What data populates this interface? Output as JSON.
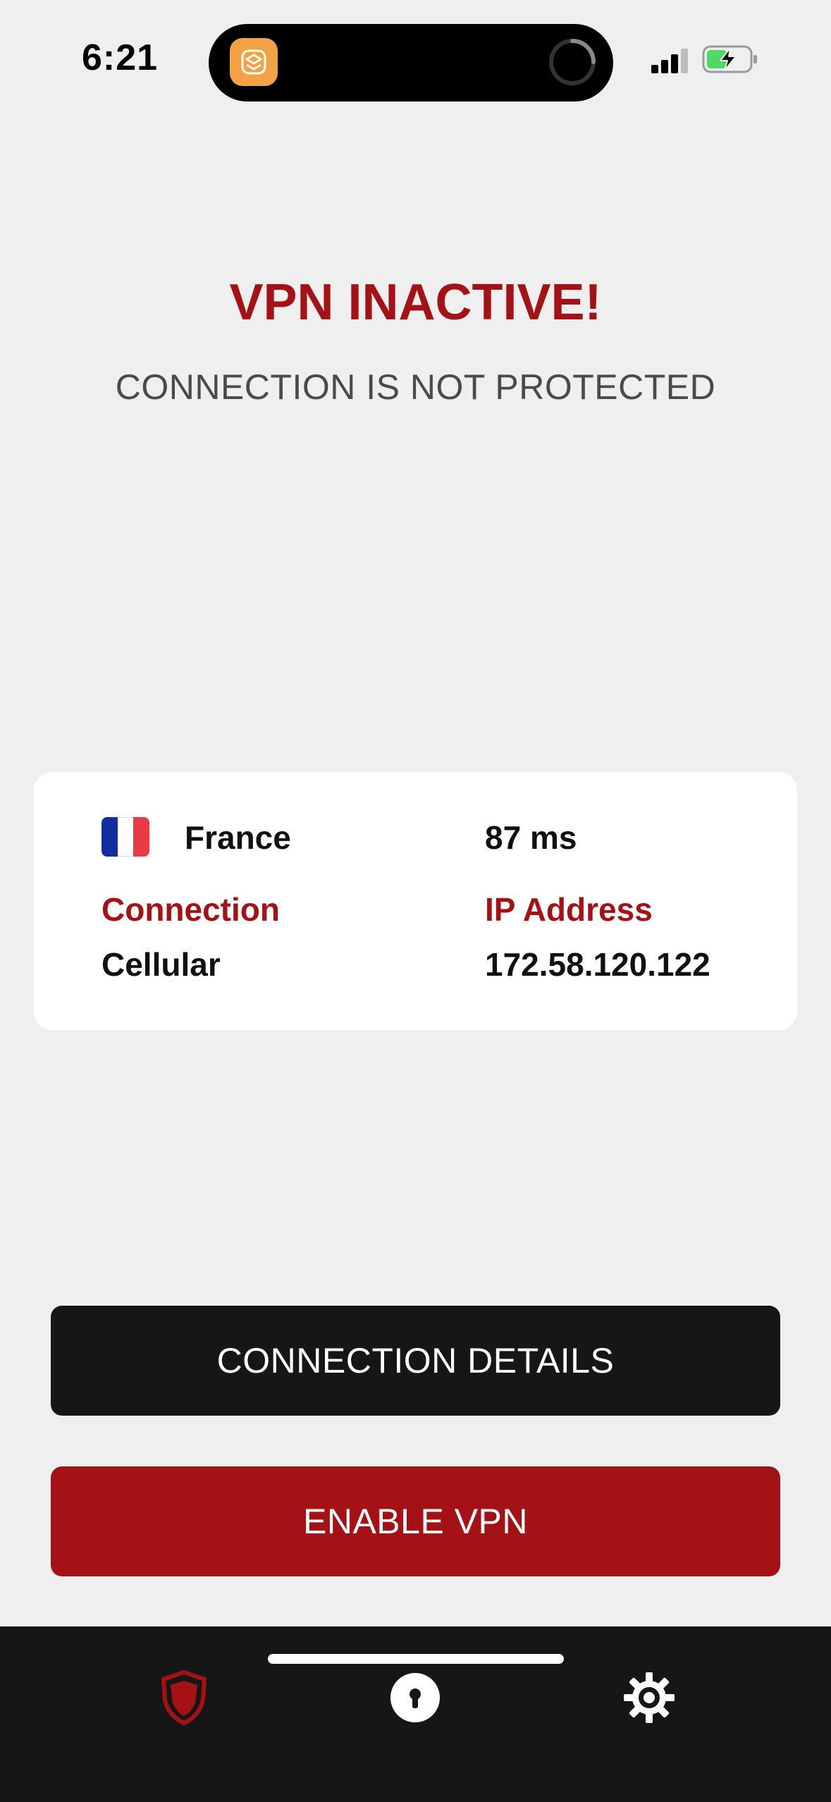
{
  "status_bar": {
    "time": "6:21"
  },
  "status": {
    "title": "VPN INACTIVE!",
    "subtitle": "CONNECTION IS NOT PROTECTED"
  },
  "info": {
    "country": "France",
    "latency": "87 ms",
    "connection_label": "Connection",
    "connection_value": "Cellular",
    "ip_label": "IP Address",
    "ip_value": "172.58.120.122"
  },
  "buttons": {
    "details_label": "CONNECTION DETAILS",
    "enable_label": "ENABLE VPN"
  },
  "tabs": [
    {
      "icon": "shield-icon",
      "active": true
    },
    {
      "icon": "keyhole-icon",
      "active": false
    },
    {
      "icon": "gear-icon",
      "active": false
    }
  ],
  "colors": {
    "accent_red": "#a51215",
    "background": "#efefef",
    "dark": "#161616"
  }
}
